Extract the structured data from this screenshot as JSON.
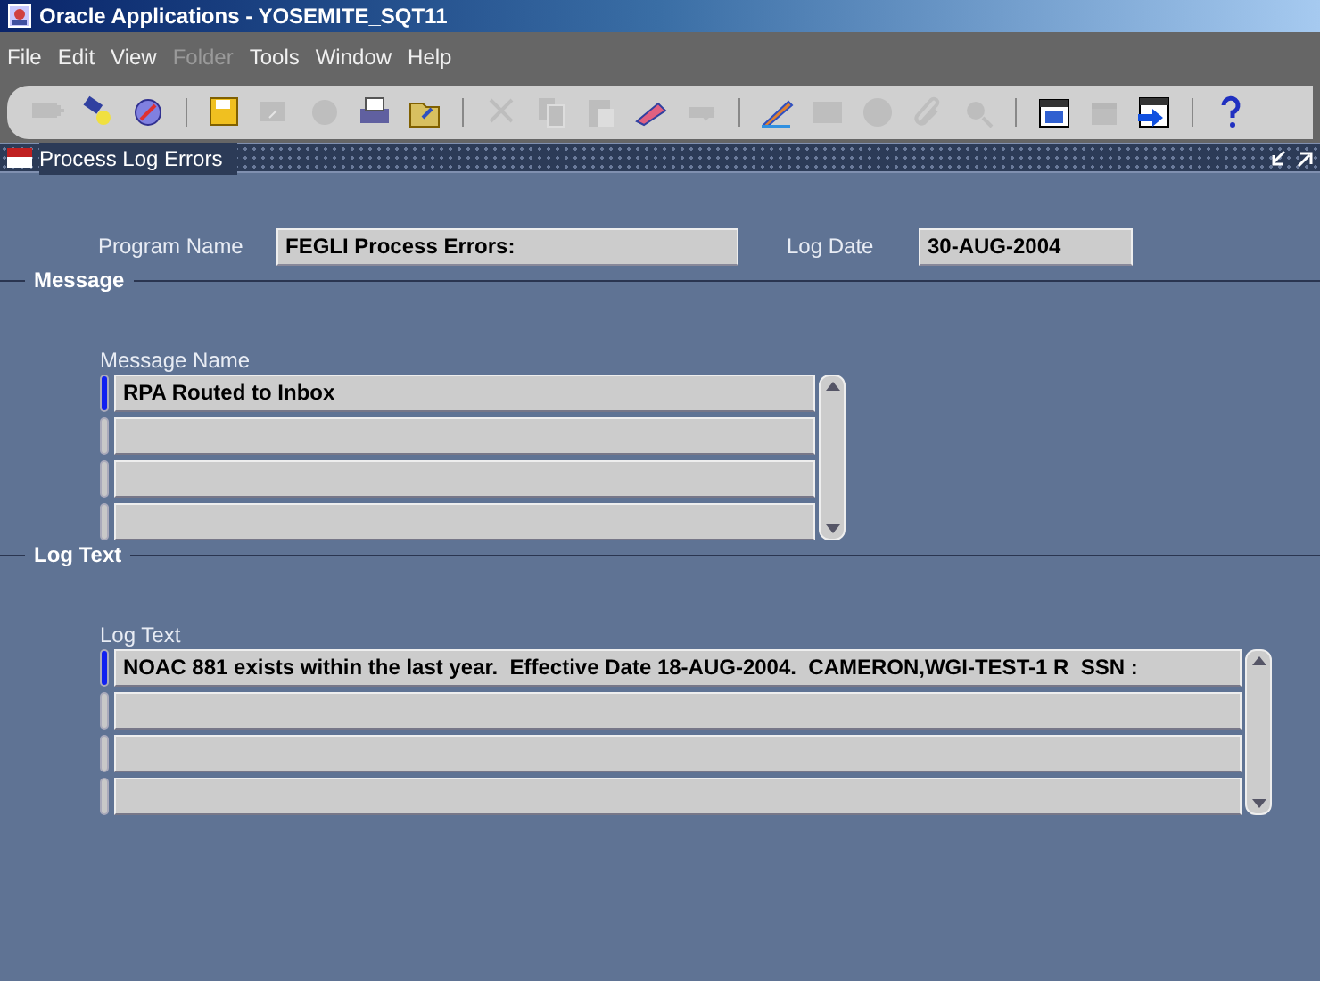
{
  "window": {
    "title": "Oracle Applications - YOSEMITE_SQT11"
  },
  "menu": [
    {
      "label": "File",
      "disabled": false
    },
    {
      "label": "Edit",
      "disabled": false
    },
    {
      "label": "View",
      "disabled": false
    },
    {
      "label": "Folder",
      "disabled": true
    },
    {
      "label": "Tools",
      "disabled": false
    },
    {
      "label": "Window",
      "disabled": false
    },
    {
      "label": "Help",
      "disabled": false
    }
  ],
  "toolbar": [
    {
      "kind": "new",
      "disabled": true
    },
    {
      "kind": "find",
      "disabled": false
    },
    {
      "kind": "navigator",
      "disabled": false
    },
    {
      "kind": "sep"
    },
    {
      "kind": "save",
      "disabled": false
    },
    {
      "kind": "next",
      "disabled": true
    },
    {
      "kind": "switch",
      "disabled": true
    },
    {
      "kind": "print",
      "disabled": false
    },
    {
      "kind": "close",
      "disabled": false
    },
    {
      "kind": "sep"
    },
    {
      "kind": "cut",
      "disabled": true
    },
    {
      "kind": "copy",
      "disabled": true
    },
    {
      "kind": "paste",
      "disabled": true
    },
    {
      "kind": "clear",
      "disabled": false
    },
    {
      "kind": "delete",
      "disabled": true
    },
    {
      "kind": "sep"
    },
    {
      "kind": "edit",
      "disabled": false
    },
    {
      "kind": "zoom",
      "disabled": true
    },
    {
      "kind": "globe",
      "disabled": true
    },
    {
      "kind": "attach",
      "disabled": true
    },
    {
      "kind": "tools",
      "disabled": true
    },
    {
      "kind": "sep"
    },
    {
      "kind": "calendar",
      "disabled": false
    },
    {
      "kind": "calendar2",
      "disabled": true
    },
    {
      "kind": "window",
      "disabled": false
    },
    {
      "kind": "sep"
    },
    {
      "kind": "help",
      "disabled": false
    }
  ],
  "form": {
    "title": "Process Log Errors",
    "program_name": {
      "label": "Program Name",
      "value": "FEGLI Process Errors:"
    },
    "log_date": {
      "label": "Log Date",
      "value": "30-AUG-2004"
    },
    "message": {
      "heading": "Message",
      "column": "Message Name",
      "rows": [
        {
          "value": "RPA Routed to Inbox",
          "selected": true
        },
        {
          "selected": false
        },
        {
          "selected": false
        },
        {
          "selected": false
        }
      ]
    },
    "log_text": {
      "heading": "Log Text",
      "column": "Log Text",
      "rows": [
        {
          "value": "NOAC 881 exists within the last year.  Effective Date 18-AUG-2004.  CAMERON,WGI-TEST-1 R  SSN :",
          "selected": true
        },
        {
          "selected": false
        },
        {
          "selected": false
        },
        {
          "selected": false
        }
      ]
    }
  }
}
